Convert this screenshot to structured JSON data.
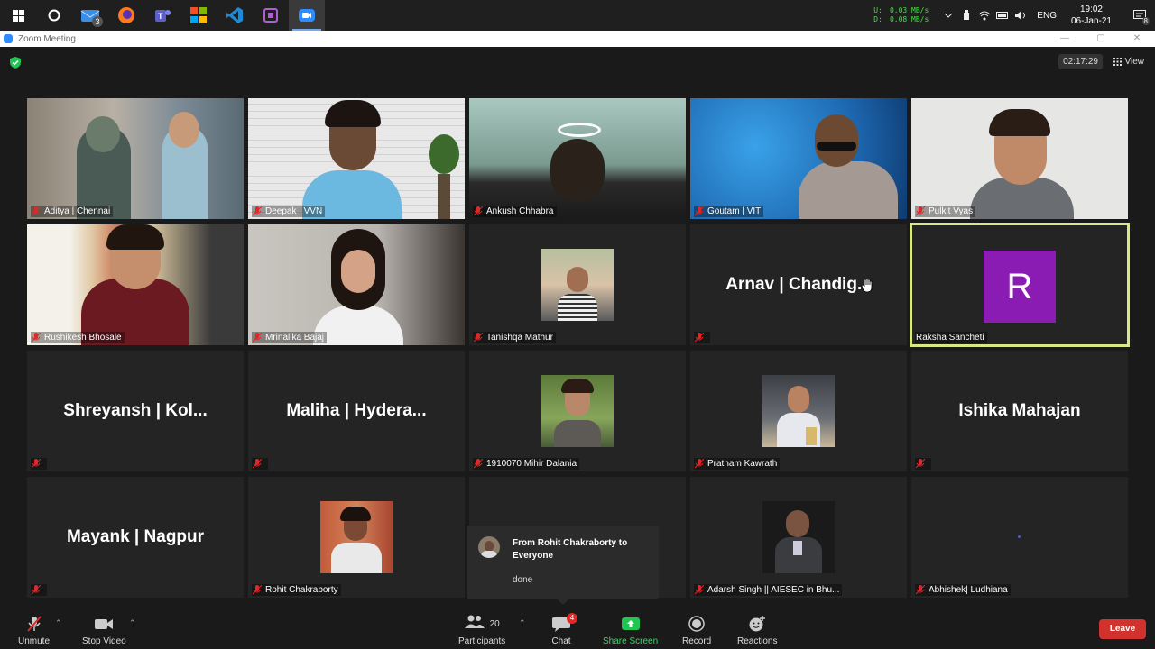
{
  "taskbar": {
    "apps": [
      "start-icon",
      "cortana-icon",
      "mail-icon",
      "firefox-icon",
      "teams-icon",
      "office-icon",
      "vscode-icon",
      "app-icon",
      "zoom-icon"
    ],
    "mail_badge": "3",
    "net_up_label": "U:",
    "net_up": "0.03 MB/s",
    "net_down_label": "D:",
    "net_down": "0.08 MB/s",
    "lang": "ENG",
    "time": "19:02",
    "date": "06-Jan-21",
    "notif_count": "8"
  },
  "window": {
    "title": "Zoom Meeting"
  },
  "meeting": {
    "timer": "02:17:29",
    "view_label": "View",
    "participants": [
      {
        "name": "Aditya | Chennai",
        "type": "video"
      },
      {
        "name": "Deepak | VVN",
        "type": "video"
      },
      {
        "name": "Ankush Chhabra",
        "type": "video"
      },
      {
        "name": "Goutam | VIT",
        "type": "video"
      },
      {
        "name": "Pulkit Vyas",
        "type": "video"
      },
      {
        "name": "Rushikesh Bhosale",
        "type": "video"
      },
      {
        "name": "Mrinalika Bajaj",
        "type": "video"
      },
      {
        "name": "Tanishqa Mathur",
        "type": "photo"
      },
      {
        "name": "Arnav | Chandig...",
        "type": "name"
      },
      {
        "name": "Raksha Sancheti",
        "type": "initial",
        "initial": "R"
      },
      {
        "name": "Shreyansh | Kol...",
        "type": "name"
      },
      {
        "name": "Maliha | Hydera...",
        "type": "name"
      },
      {
        "name": "1910070 Mihir Dalania",
        "type": "photo"
      },
      {
        "name": "Pratham Kawrath",
        "type": "photo"
      },
      {
        "name": "Ishika Mahajan",
        "type": "name"
      },
      {
        "name": "Mayank | Nagpur",
        "type": "name"
      },
      {
        "name": "Rohit Chakraborty",
        "type": "photo"
      },
      {
        "name": "",
        "type": "blank"
      },
      {
        "name": "Adarsh Singh || AIESEC in Bhu...",
        "type": "photo"
      },
      {
        "name": "Abhishek| Ludhiana",
        "type": "blank"
      }
    ],
    "chat_popup": {
      "from": "From Rohit Chakraborty to Everyone",
      "message": "done"
    }
  },
  "toolbar": {
    "unmute": "Unmute",
    "stop_video": "Stop Video",
    "participants": "Participants",
    "participants_count": "20",
    "chat": "Chat",
    "chat_badge": "4",
    "share_screen": "Share Screen",
    "record": "Record",
    "reactions": "Reactions",
    "leave": "Leave"
  },
  "colors": {
    "speaking_border": "#d8e886",
    "leave_bg": "#d2322d",
    "share_green": "#3fd36a",
    "avatar_purple": "#8a1cb4"
  }
}
